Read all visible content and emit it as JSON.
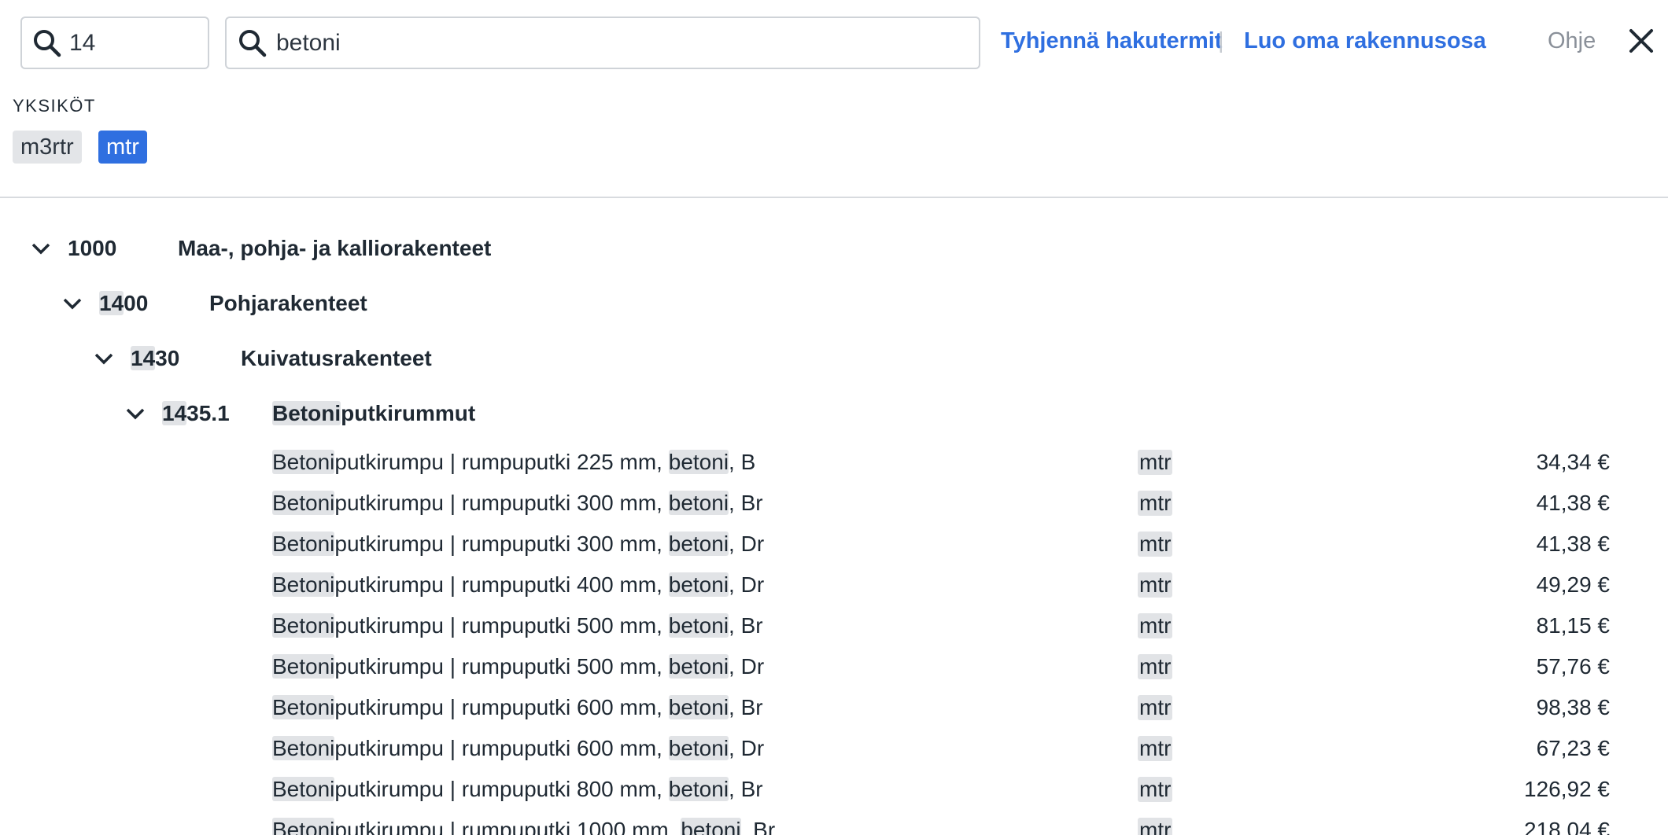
{
  "search": {
    "code_value": "14",
    "text_value": "betoni"
  },
  "toolbar": {
    "clear_label": "Tyhjennä hakutermit",
    "separator": "|",
    "create_label": "Luo oma rakennusosa",
    "help_label": "Ohje"
  },
  "units": {
    "label": "YKSIKÖT",
    "chips": [
      {
        "label": "m3rtr",
        "selected": false
      },
      {
        "label": "mtr",
        "selected": true
      }
    ]
  },
  "tree": {
    "level1": {
      "code_hl": "",
      "code_rest": "1000",
      "name": "Maa-, pohja- ja kalliorakenteet"
    },
    "level2": {
      "code_hl": "14",
      "code_rest": "00",
      "name": "Pohjarakenteet"
    },
    "level3": {
      "code_hl": "14",
      "code_rest": "30",
      "name": "Kuivatusrakenteet"
    },
    "level4": {
      "code_hl": "14",
      "code_rest": "35.1",
      "name_hl": "Betoni",
      "name_rest": "putkirummut"
    }
  },
  "rows": [
    {
      "prefix": "Betoni",
      "mid": "putkirumpu | rumpuputki 225 mm, ",
      "match": "betoni",
      "suffix": ", B",
      "unit": "mtr",
      "price": "34,34 €"
    },
    {
      "prefix": "Betoni",
      "mid": "putkirumpu | rumpuputki 300 mm, ",
      "match": "betoni",
      "suffix": ", Br",
      "unit": "mtr",
      "price": "41,38 €"
    },
    {
      "prefix": "Betoni",
      "mid": "putkirumpu | rumpuputki 300 mm, ",
      "match": "betoni",
      "suffix": ", Dr",
      "unit": "mtr",
      "price": "41,38 €"
    },
    {
      "prefix": "Betoni",
      "mid": "putkirumpu | rumpuputki 400 mm, ",
      "match": "betoni",
      "suffix": ", Dr",
      "unit": "mtr",
      "price": "49,29 €"
    },
    {
      "prefix": "Betoni",
      "mid": "putkirumpu | rumpuputki 500 mm, ",
      "match": "betoni",
      "suffix": ", Br",
      "unit": "mtr",
      "price": "81,15 €"
    },
    {
      "prefix": "Betoni",
      "mid": "putkirumpu | rumpuputki 500 mm, ",
      "match": "betoni",
      "suffix": ", Dr",
      "unit": "mtr",
      "price": "57,76 €"
    },
    {
      "prefix": "Betoni",
      "mid": "putkirumpu | rumpuputki 600 mm, ",
      "match": "betoni",
      "suffix": ", Br",
      "unit": "mtr",
      "price": "98,38 €"
    },
    {
      "prefix": "Betoni",
      "mid": "putkirumpu | rumpuputki 600 mm, ",
      "match": "betoni",
      "suffix": ", Dr",
      "unit": "mtr",
      "price": "67,23 €"
    },
    {
      "prefix": "Betoni",
      "mid": "putkirumpu | rumpuputki 800 mm, ",
      "match": "betoni",
      "suffix": ", Br",
      "unit": "mtr",
      "price": "126,92 €"
    },
    {
      "prefix": "Betoni",
      "mid": "putkirumpu | rumpuputki 1000 mm, ",
      "match": "betoni",
      "suffix": ", Br",
      "unit": "mtr",
      "price": "218,04 €"
    }
  ],
  "colors": {
    "accent": "#2f6fe0",
    "highlight": "#e1e3e6"
  }
}
